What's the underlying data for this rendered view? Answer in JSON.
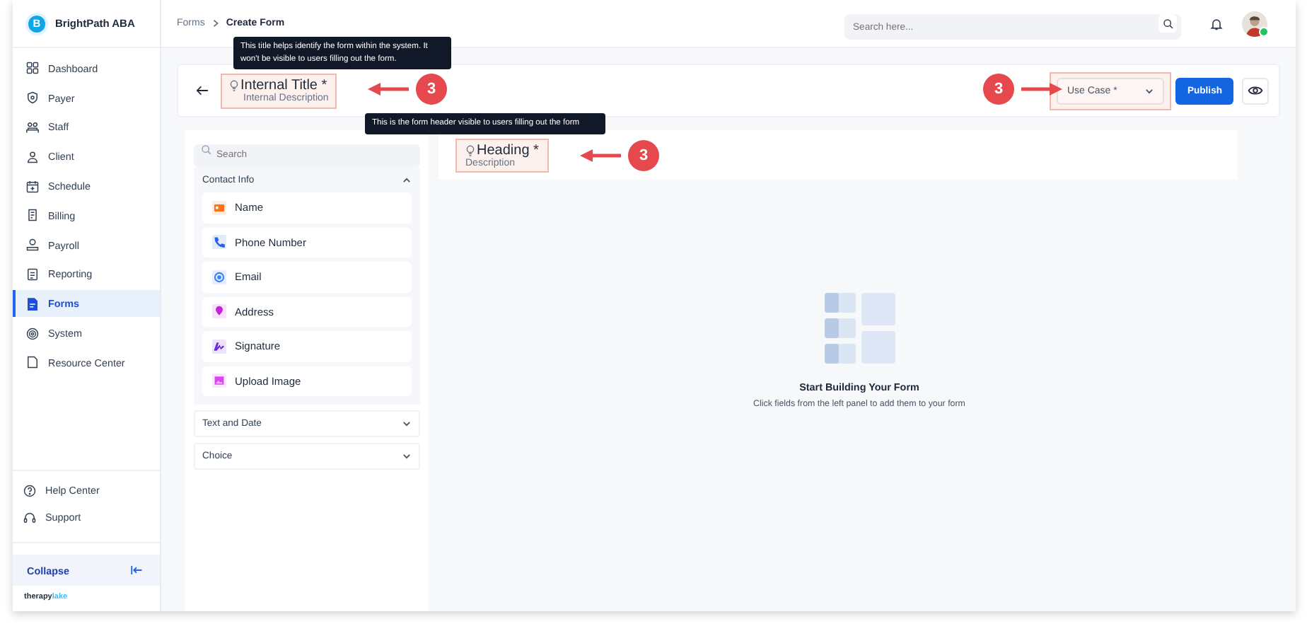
{
  "brand": {
    "name": "BrightPath ABA",
    "logo_letter": "B"
  },
  "sidebar": {
    "items": [
      {
        "label": "Dashboard",
        "selected": false
      },
      {
        "label": "Payer",
        "selected": false
      },
      {
        "label": "Staff",
        "selected": false
      },
      {
        "label": "Client",
        "selected": false
      },
      {
        "label": "Schedule",
        "selected": false
      },
      {
        "label": "Billing",
        "selected": false
      },
      {
        "label": "Payroll",
        "selected": false
      },
      {
        "label": "Reporting",
        "selected": false
      },
      {
        "label": "Forms",
        "selected": true
      },
      {
        "label": "System",
        "selected": false
      },
      {
        "label": "Resource Center",
        "selected": false
      }
    ],
    "footer_items": [
      {
        "label": "Help Center"
      },
      {
        "label": "Support"
      }
    ],
    "collapse": "Collapse",
    "vendor": {
      "prefix": "therapy",
      "suffix": "lake"
    }
  },
  "breadcrumb": [
    {
      "label": "Forms",
      "current": false
    },
    {
      "label": "Create Form",
      "current": true
    }
  ],
  "search": {
    "placeholder": "Search here..."
  },
  "user": {
    "online": true
  },
  "header": {
    "title": "Internal Title *",
    "description": "Internal Description",
    "use_case": {
      "placeholder": "Use Case *"
    },
    "publish": "Publish"
  },
  "tooltips": [
    {
      "text": "This title helps identify the form within the system. It won't be visible to users filling out the form."
    },
    {
      "text": "This is the form header visible to users filling out the form"
    }
  ],
  "field_panel": {
    "search_placeholder": "Search",
    "groups": [
      {
        "title": "Contact Info",
        "expanded": true,
        "fields": [
          {
            "label": "Name",
            "color": "#f97316"
          },
          {
            "label": "Phone Number",
            "color": "#2563eb"
          },
          {
            "label": "Email",
            "color": "#3b82f6"
          },
          {
            "label": "Address",
            "color": "#c026d3"
          },
          {
            "label": "Signature",
            "color": "#6d28d9"
          },
          {
            "label": "Upload Image",
            "color": "#d946ef"
          }
        ]
      },
      {
        "title": "Text and Date",
        "expanded": false
      },
      {
        "title": "Choice",
        "expanded": false
      }
    ]
  },
  "canvas": {
    "heading": "Heading *",
    "description": "Description",
    "empty_title": "Start Building Your Form",
    "empty_text": "Click fields from the left panel to add them to your form"
  },
  "annotations": [
    {
      "label": "3",
      "kind": "left"
    },
    {
      "label": "3",
      "kind": "left"
    },
    {
      "label": "3",
      "kind": "right"
    }
  ]
}
